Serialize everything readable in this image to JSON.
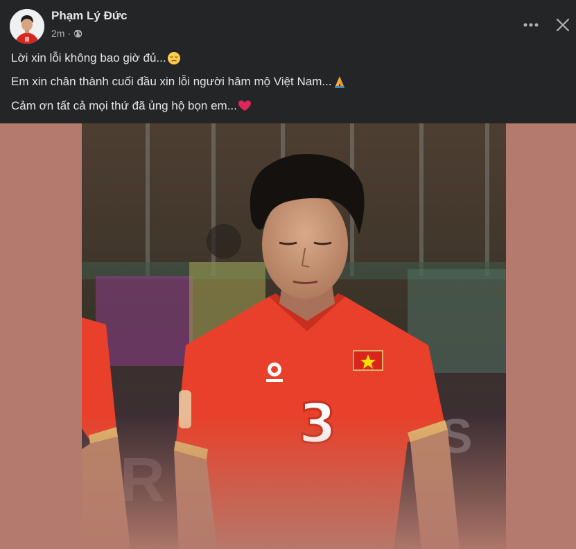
{
  "post": {
    "author": "Phạm Lý Đức",
    "time": "2m",
    "separator": "·",
    "privacy_icon": "globe-icon",
    "lines": [
      {
        "text": "Lời xin lỗi không bao giờ đủ...",
        "emoji": "pensive-face-emoji"
      },
      {
        "text": "Em xin chân thành cuối đầu xin lỗi người hâm mộ Việt Nam...",
        "emoji": "folded-hands-emoji"
      },
      {
        "text": "Cảm ơn tất cả mọi thứ đã ủng hộ bọn em...",
        "emoji": "red-heart-emoji"
      }
    ]
  },
  "photo": {
    "shirt_number": "3",
    "jersey_color": "#e8402a",
    "background_color": "#b47a6d"
  },
  "colors": {
    "panel": "#242526",
    "primary_text": "#e4e6eb",
    "secondary_text": "#b0b3b8"
  }
}
